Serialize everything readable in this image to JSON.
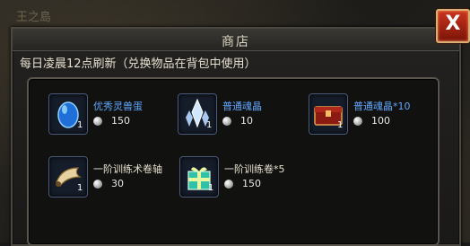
{
  "background": {
    "title": "王之島"
  },
  "window": {
    "title": "商店",
    "close_label": "X"
  },
  "notice": "每日凌晨12点刷新（兑换物品在背包中使用）",
  "items": [
    {
      "name": "优秀灵兽蛋",
      "qty": "1",
      "price": "150",
      "icon": "blue-egg-icon",
      "name_color": "blue"
    },
    {
      "name": "普通魂晶",
      "qty": "1",
      "price": "10",
      "icon": "soul-crystal-icon",
      "name_color": "blue"
    },
    {
      "name": "普通魂晶*10",
      "qty": "1",
      "price": "100",
      "icon": "treasure-chest-icon",
      "name_color": "blue"
    },
    {
      "name": "一阶训练术卷轴",
      "qty": "1",
      "price": "30",
      "icon": "scroll-icon",
      "name_color": "white"
    },
    {
      "name": "一阶训练卷*5",
      "qty": "1",
      "price": "150",
      "icon": "gift-box-icon",
      "name_color": "white"
    }
  ],
  "colors": {
    "blue_name": "#5fa8ff",
    "close_red": "#c8341d"
  }
}
